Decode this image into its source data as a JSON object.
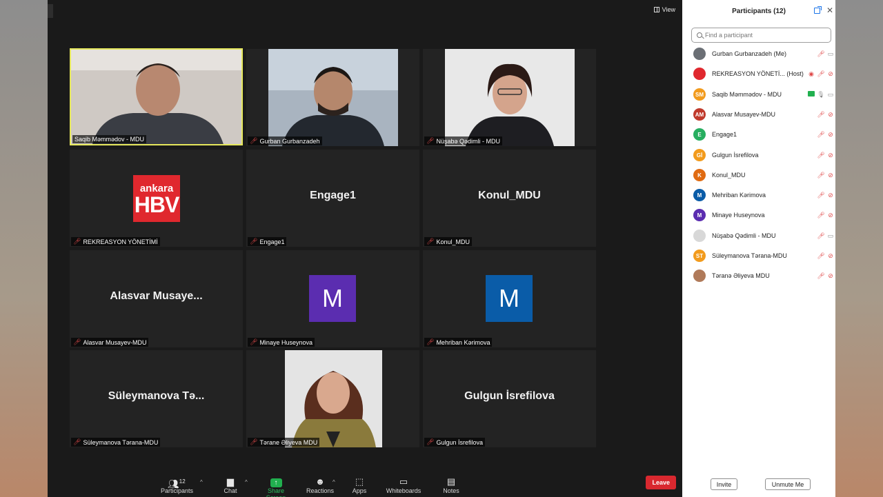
{
  "meeting": {
    "view_label": "View",
    "tiles": [
      {
        "big_name": "",
        "tag": "Saqib Məmmədov - MDU",
        "muted": false,
        "kind": "photo"
      },
      {
        "big_name": "",
        "tag": "Gurban Gurbanzadeh",
        "muted": true,
        "kind": "photo"
      },
      {
        "big_name": "",
        "tag": "Nüşabə Qədimli - MDU",
        "muted": true,
        "kind": "photo"
      },
      {
        "big_name": "",
        "tag": "REKREASYON YÖNETİMİ",
        "muted": true,
        "kind": "logo",
        "logo_top": "ankara",
        "logo_bottom": "HBV"
      },
      {
        "big_name": "Engage1",
        "tag": "Engage1",
        "muted": true,
        "kind": "name"
      },
      {
        "big_name": "Konul_MDU",
        "tag": "Konul_MDU",
        "muted": true,
        "kind": "name"
      },
      {
        "big_name": "Alasvar  Musaye...",
        "tag": "Alasvar Musayev-MDU",
        "muted": true,
        "kind": "name"
      },
      {
        "big_name": "M",
        "tag": "Minaye Huseynova",
        "muted": true,
        "kind": "avatar",
        "color": "#5b2db0"
      },
      {
        "big_name": "M",
        "tag": "Mehriban Kərimova",
        "muted": true,
        "kind": "avatar",
        "color": "#0a5ca8"
      },
      {
        "big_name": "Süleymanova  Tə...",
        "tag": "Süleymanova Tərana-MDU",
        "muted": true,
        "kind": "name"
      },
      {
        "big_name": "",
        "tag": "Tərane Əliyeva MDU",
        "muted": true,
        "kind": "photo"
      },
      {
        "big_name": "Gulgun İsrefilova",
        "tag": "Gulgun İsrefilova",
        "muted": true,
        "kind": "name"
      }
    ]
  },
  "toolbar": {
    "participants_label": "Participants",
    "participants_count": "12",
    "chat_label": "Chat",
    "share_label": "Share Screen",
    "reactions_label": "Reactions",
    "apps_label": "Apps",
    "whiteboards_label": "Whiteboards",
    "notes_label": "Notes",
    "leave_label": "Leave"
  },
  "panel": {
    "title": "Participants (12)",
    "search_placeholder": "Find a participant",
    "participants": [
      {
        "name": "Gurban Gurbanzadeh (Me)",
        "initials": "",
        "color": "#6b6f75",
        "mic": "muted",
        "video": "on"
      },
      {
        "name": "REKREASYON YÖNETİ... (Host)",
        "initials": "",
        "color": "#e0282e",
        "mic": "muted",
        "video": "off"
      },
      {
        "name": "Saqib Məmmədov - MDU",
        "initials": "SM",
        "color": "#f29b1d",
        "mic": "on",
        "video": "on"
      },
      {
        "name": "Alasvar Musayev-MDU",
        "initials": "AM",
        "color": "#c0392b",
        "mic": "muted",
        "video": "off"
      },
      {
        "name": "Engage1",
        "initials": "E",
        "color": "#27ae60",
        "mic": "muted",
        "video": "off"
      },
      {
        "name": "Gulgun İsrefilova",
        "initials": "Gİ",
        "color": "#f29b1d",
        "mic": "muted",
        "video": "off"
      },
      {
        "name": "Konul_MDU",
        "initials": "K",
        "color": "#e06b12",
        "mic": "muted",
        "video": "off"
      },
      {
        "name": "Mehriban Kərimova",
        "initials": "M",
        "color": "#0a5ca8",
        "mic": "muted",
        "video": "off"
      },
      {
        "name": "Minaye Huseynova",
        "initials": "M",
        "color": "#5b2db0",
        "mic": "muted",
        "video": "off"
      },
      {
        "name": "Nüşabə Qədimli - MDU",
        "initials": "",
        "color": "#d8d8d8",
        "mic": "muted",
        "video": "on"
      },
      {
        "name": "Süleymanova Tərana-MDU",
        "initials": "ST",
        "color": "#f29b1d",
        "mic": "muted",
        "video": "off"
      },
      {
        "name": "Təranə Əliyeva MDU",
        "initials": "",
        "color": "#b07a5a",
        "mic": "muted",
        "video": "off"
      }
    ],
    "invite_label": "Invite",
    "unmute_label": "Unmute Me"
  }
}
